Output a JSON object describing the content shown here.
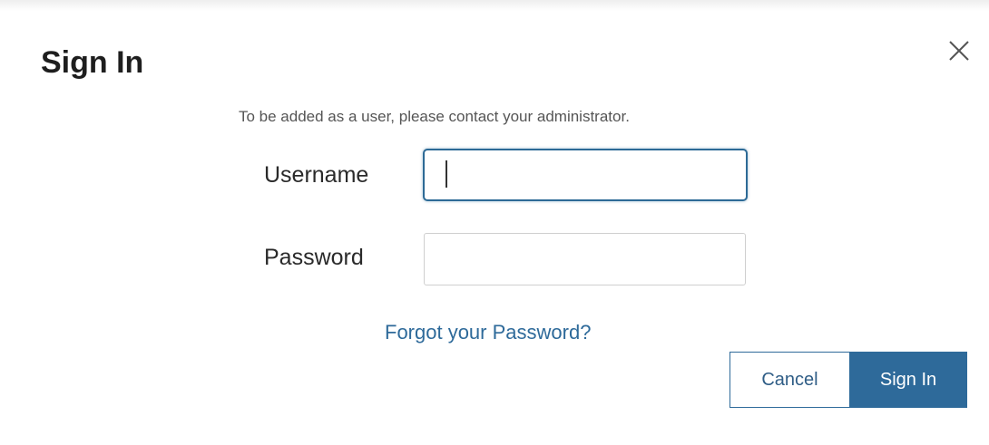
{
  "dialog": {
    "title": "Sign In",
    "info_text": "To be added as a user, please contact your administrator.",
    "username": {
      "label": "Username",
      "value": "",
      "placeholder": ""
    },
    "password": {
      "label": "Password",
      "value": "",
      "placeholder": ""
    },
    "forgot_link": "Forgot your Password?",
    "cancel_label": "Cancel",
    "signin_label": "Sign In"
  },
  "icons": {
    "close": "close-icon"
  },
  "colors": {
    "accent": "#2e6a9a",
    "title_text": "#1e1e1e",
    "info_text": "#555555"
  }
}
